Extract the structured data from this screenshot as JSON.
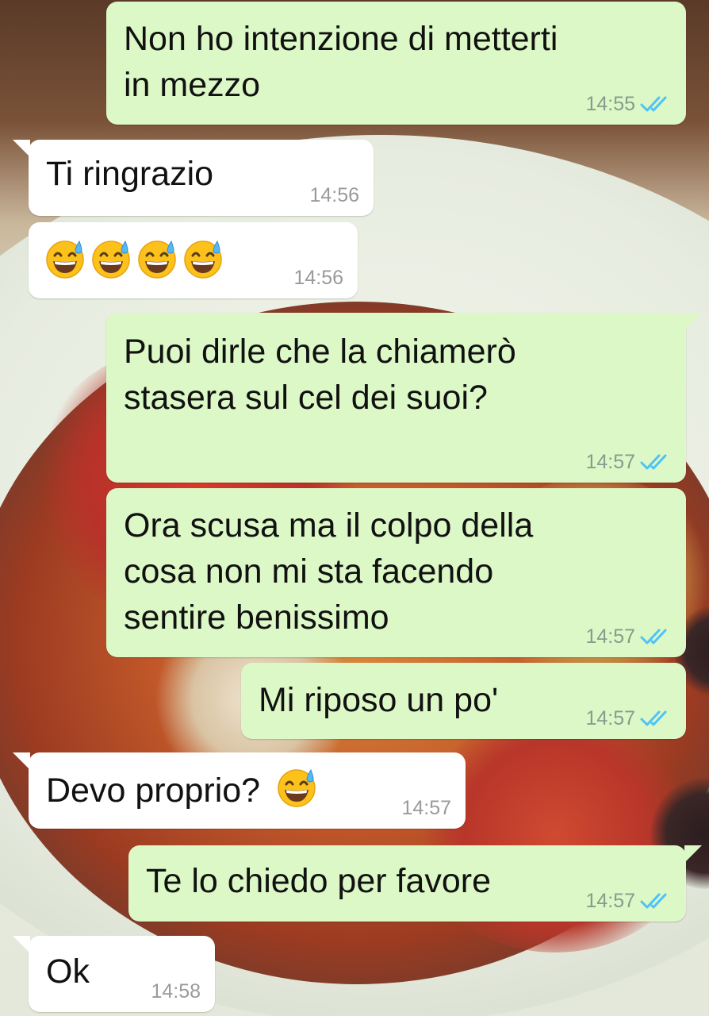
{
  "conversation": {
    "messages": [
      {
        "direction": "out",
        "text_lines": [
          "Non ho intenzione di metterti",
          "in mezzo"
        ],
        "time": "14:55",
        "read": true
      },
      {
        "direction": "in",
        "text_lines": [
          "Ti ringrazio"
        ],
        "time": "14:56"
      },
      {
        "direction": "in",
        "text_lines": [
          "😅😅😅😅"
        ],
        "emoji_count": 4,
        "time": "14:56"
      },
      {
        "direction": "out",
        "text_lines": [
          "Puoi dirle che la chiamerò",
          "stasera sul cel dei suoi?"
        ],
        "time": "14:57",
        "read": true
      },
      {
        "direction": "out",
        "text_lines": [
          "Ora scusa ma il colpo della",
          "cosa non mi sta facendo",
          "sentire benissimo"
        ],
        "time": "14:57",
        "read": true
      },
      {
        "direction": "out",
        "text_lines": [
          "Mi riposo un po'"
        ],
        "time": "14:57",
        "read": true
      },
      {
        "direction": "in",
        "text_lines": [
          "Devo proprio?"
        ],
        "emoji": "😅",
        "time": "14:57"
      },
      {
        "direction": "out",
        "text_lines": [
          "Te lo chiedo per favore"
        ],
        "time": "14:57",
        "read": true
      },
      {
        "direction": "in",
        "text_lines": [
          "Ok"
        ],
        "time": "14:58"
      }
    ]
  },
  "colors": {
    "outgoing_bubble": "#dcf8c6",
    "incoming_bubble": "#ffffff",
    "read_ticks": "#4fc3f7",
    "timestamp": "#8a9a8e"
  },
  "icons": {
    "read_receipt": "double-check-icon",
    "emoji": "grinning-face-with-sweat-emoji"
  }
}
